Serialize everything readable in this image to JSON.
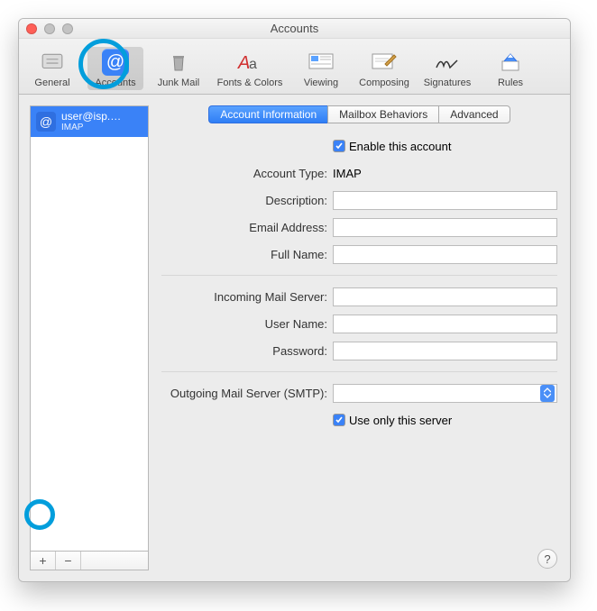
{
  "window": {
    "title": "Accounts"
  },
  "toolbar": {
    "items": [
      {
        "label": "General"
      },
      {
        "label": "Accounts"
      },
      {
        "label": "Junk Mail"
      },
      {
        "label": "Fonts & Colors"
      },
      {
        "label": "Viewing"
      },
      {
        "label": "Composing"
      },
      {
        "label": "Signatures"
      },
      {
        "label": "Rules"
      }
    ]
  },
  "sidebar": {
    "account": {
      "name": "user@isp.…",
      "type": "IMAP"
    },
    "add_label": "+",
    "remove_label": "−"
  },
  "tabs": {
    "info": "Account Information",
    "behaviors": "Mailbox Behaviors",
    "advanced": "Advanced"
  },
  "form": {
    "enable_label": "Enable this account",
    "account_type_label": "Account Type:",
    "account_type_value": "IMAP",
    "description_label": "Description:",
    "description_value": "",
    "email_label": "Email Address:",
    "email_value": "",
    "fullname_label": "Full Name:",
    "fullname_value": "",
    "incoming_label": "Incoming Mail Server:",
    "incoming_value": "",
    "username_label": "User Name:",
    "username_value": "",
    "password_label": "Password:",
    "password_value": "",
    "outgoing_label": "Outgoing Mail Server (SMTP):",
    "outgoing_value": "",
    "useonly_label": "Use only this server"
  },
  "help_label": "?"
}
